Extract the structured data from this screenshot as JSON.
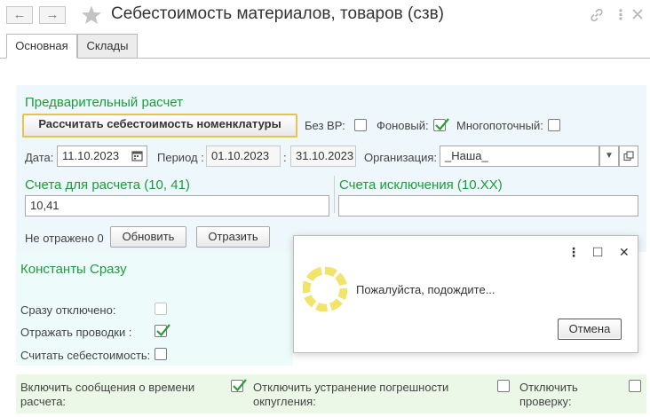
{
  "window": {
    "title": "Себестоимость материалов, товаров (сзв)",
    "nav_back": "←",
    "nav_forward": "→"
  },
  "tabs": [
    {
      "label": "Основная",
      "active": true
    },
    {
      "label": "Склады",
      "active": false
    }
  ],
  "precalc": {
    "title": "Предварительный расчет",
    "calc_button": "Рассчитать себестоимость номенклатуры",
    "no_vr_label": "Без ВР:",
    "no_vr_checked": false,
    "background_label": "Фоновый:",
    "background_checked": true,
    "multithread_label": "Многопоточный:",
    "multithread_checked": false,
    "date_label": "Дата:",
    "date_value": "11.10.2023",
    "period_label": "Период :",
    "period_from": "01.10.2023",
    "period_sep": ":",
    "period_to": "31.10.2023",
    "org_label": "Организация:",
    "org_value": "_Наша_",
    "accounts_title": "Счета для расчета (10, 41)",
    "accounts_value": "10,41",
    "exclusions_title": "Счета исключения (10.XX)",
    "exclusions_value": "",
    "not_reflected": "Не отражено 0",
    "refresh_button": "Обновить",
    "reflect_button": "Отразить"
  },
  "constants": {
    "title": "Константы Сразу",
    "off_label": "Сразу отключено:",
    "off_checked": false,
    "post_label": "Отражать проводки :",
    "post_checked": true,
    "cost_label": "Считать себестоимость:",
    "cost_checked": false
  },
  "bottom": {
    "messages_label_1": "Включить сообщения о времени",
    "messages_label_2": "расчета:",
    "messages_checked": true,
    "rounding_label_1": "Отключить устранение погрешности",
    "rounding_label_2": "окпугления:",
    "rounding_checked": false,
    "check_label_1": "Отключить",
    "check_label_2": "проверку:",
    "check_checked": false
  },
  "dialog": {
    "message": "Пожалуйста, подождите...",
    "cancel_button": "Отмена",
    "more_icon": "⋮",
    "maximize_icon": "□",
    "close_icon": "✕"
  },
  "colors": {
    "group_title": "#1e9b3a",
    "check_green": "#2e9b3a",
    "spinner": "#f2e36b"
  }
}
